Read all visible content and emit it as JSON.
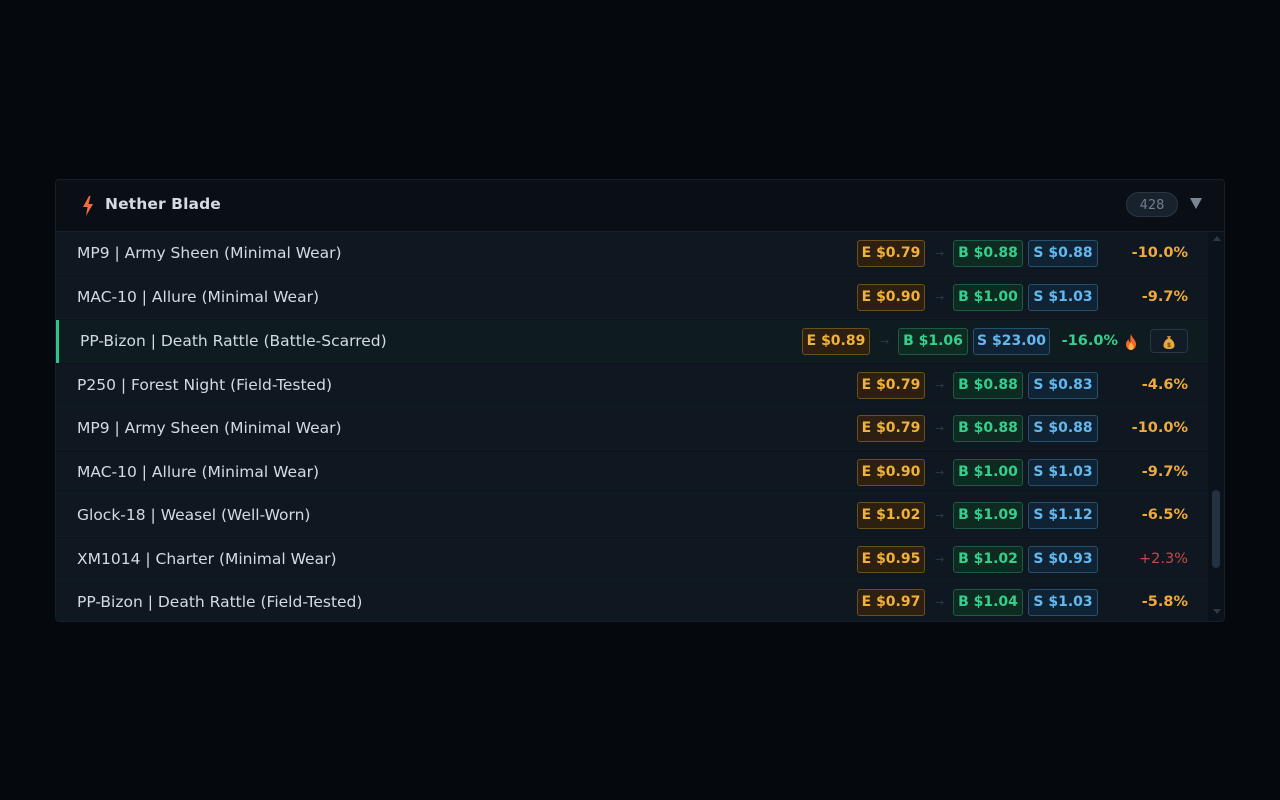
{
  "panel": {
    "title": "Nether Blade",
    "icon": "lightning-bolt-icon",
    "count": "428",
    "collapse_icon": "caret-down-icon"
  },
  "rows": [
    {
      "name": "MP9 | Army Sheen (Minimal Wear)",
      "e": "E $0.79",
      "b": "B $0.88",
      "s": "S $0.88",
      "pct": "-10.0%"
    },
    {
      "name": "MAC-10 | Allure (Minimal Wear)",
      "e": "E $0.90",
      "b": "B $1.00",
      "s": "S $1.03",
      "pct": "-9.7%"
    },
    {
      "name": "PP-Bizon | Death Rattle (Battle-Scarred)",
      "e": "E $0.89",
      "b": "B $1.06",
      "s": "S $23.00",
      "pct": "-16.0%",
      "highlight": true,
      "hot_icon": "fire-icon",
      "action_icon": "money-bag-icon"
    },
    {
      "name": "P250 | Forest Night (Field-Tested)",
      "e": "E $0.79",
      "b": "B $0.88",
      "s": "S $0.83",
      "pct": "-4.6%"
    },
    {
      "name": "MP9 | Army Sheen (Minimal Wear)",
      "e": "E $0.79",
      "b": "B $0.88",
      "s": "S $0.88",
      "pct": "-10.0%"
    },
    {
      "name": "MAC-10 | Allure (Minimal Wear)",
      "e": "E $0.90",
      "b": "B $1.00",
      "s": "S $1.03",
      "pct": "-9.7%"
    },
    {
      "name": "Glock-18 | Weasel (Well-Worn)",
      "e": "E $1.02",
      "b": "B $1.09",
      "s": "S $1.12",
      "pct": "-6.5%"
    },
    {
      "name": "XM1014 | Charter (Minimal Wear)",
      "e": "E $0.95",
      "b": "B $1.02",
      "s": "S $0.93",
      "pct": "+2.3%"
    },
    {
      "name": "PP-Bizon | Death Rattle (Field-Tested)",
      "e": "E $0.97",
      "b": "B $1.04",
      "s": "S $1.03",
      "pct": "-5.8%"
    }
  ],
  "arrow_glyph": "→",
  "colors": {
    "entry": "#f2b138",
    "buy": "#33d08d",
    "sell": "#62b8ef",
    "accent": "#2fc58a",
    "negative_pct": "#f0a93a",
    "positive_pct": "#c5484a"
  }
}
